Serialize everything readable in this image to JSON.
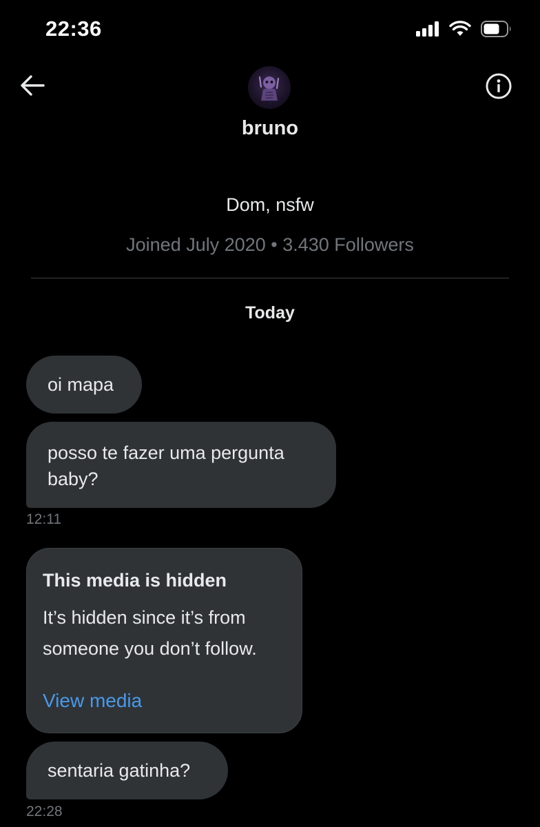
{
  "status_bar": {
    "time": "22:36",
    "icons": [
      "cellular-signal-icon",
      "wifi-icon",
      "battery-icon"
    ]
  },
  "header": {
    "contact_name": "bruno",
    "back_icon": "arrow-left-icon",
    "info_icon": "info-circle-icon"
  },
  "profile": {
    "bio": "Dom, nsfw",
    "meta": "Joined July 2020 • 3.430 Followers"
  },
  "conversation": {
    "date_label": "Today",
    "messages": [
      {
        "text": "oi mapa"
      },
      {
        "text": "posso te fazer uma pergunta baby?",
        "time": "12:11"
      },
      {
        "media_title": "This media is hidden",
        "media_body": "It’s hidden since it’s from someone you don’t follow.",
        "media_link": "View media"
      },
      {
        "text": "sentaria gatinha?",
        "time": "22:28"
      }
    ]
  },
  "colors": {
    "background": "#000000",
    "bubble": "#2f3336",
    "primary_text": "#e7e9ea",
    "secondary_text": "#71767b",
    "link": "#4a99e9"
  }
}
